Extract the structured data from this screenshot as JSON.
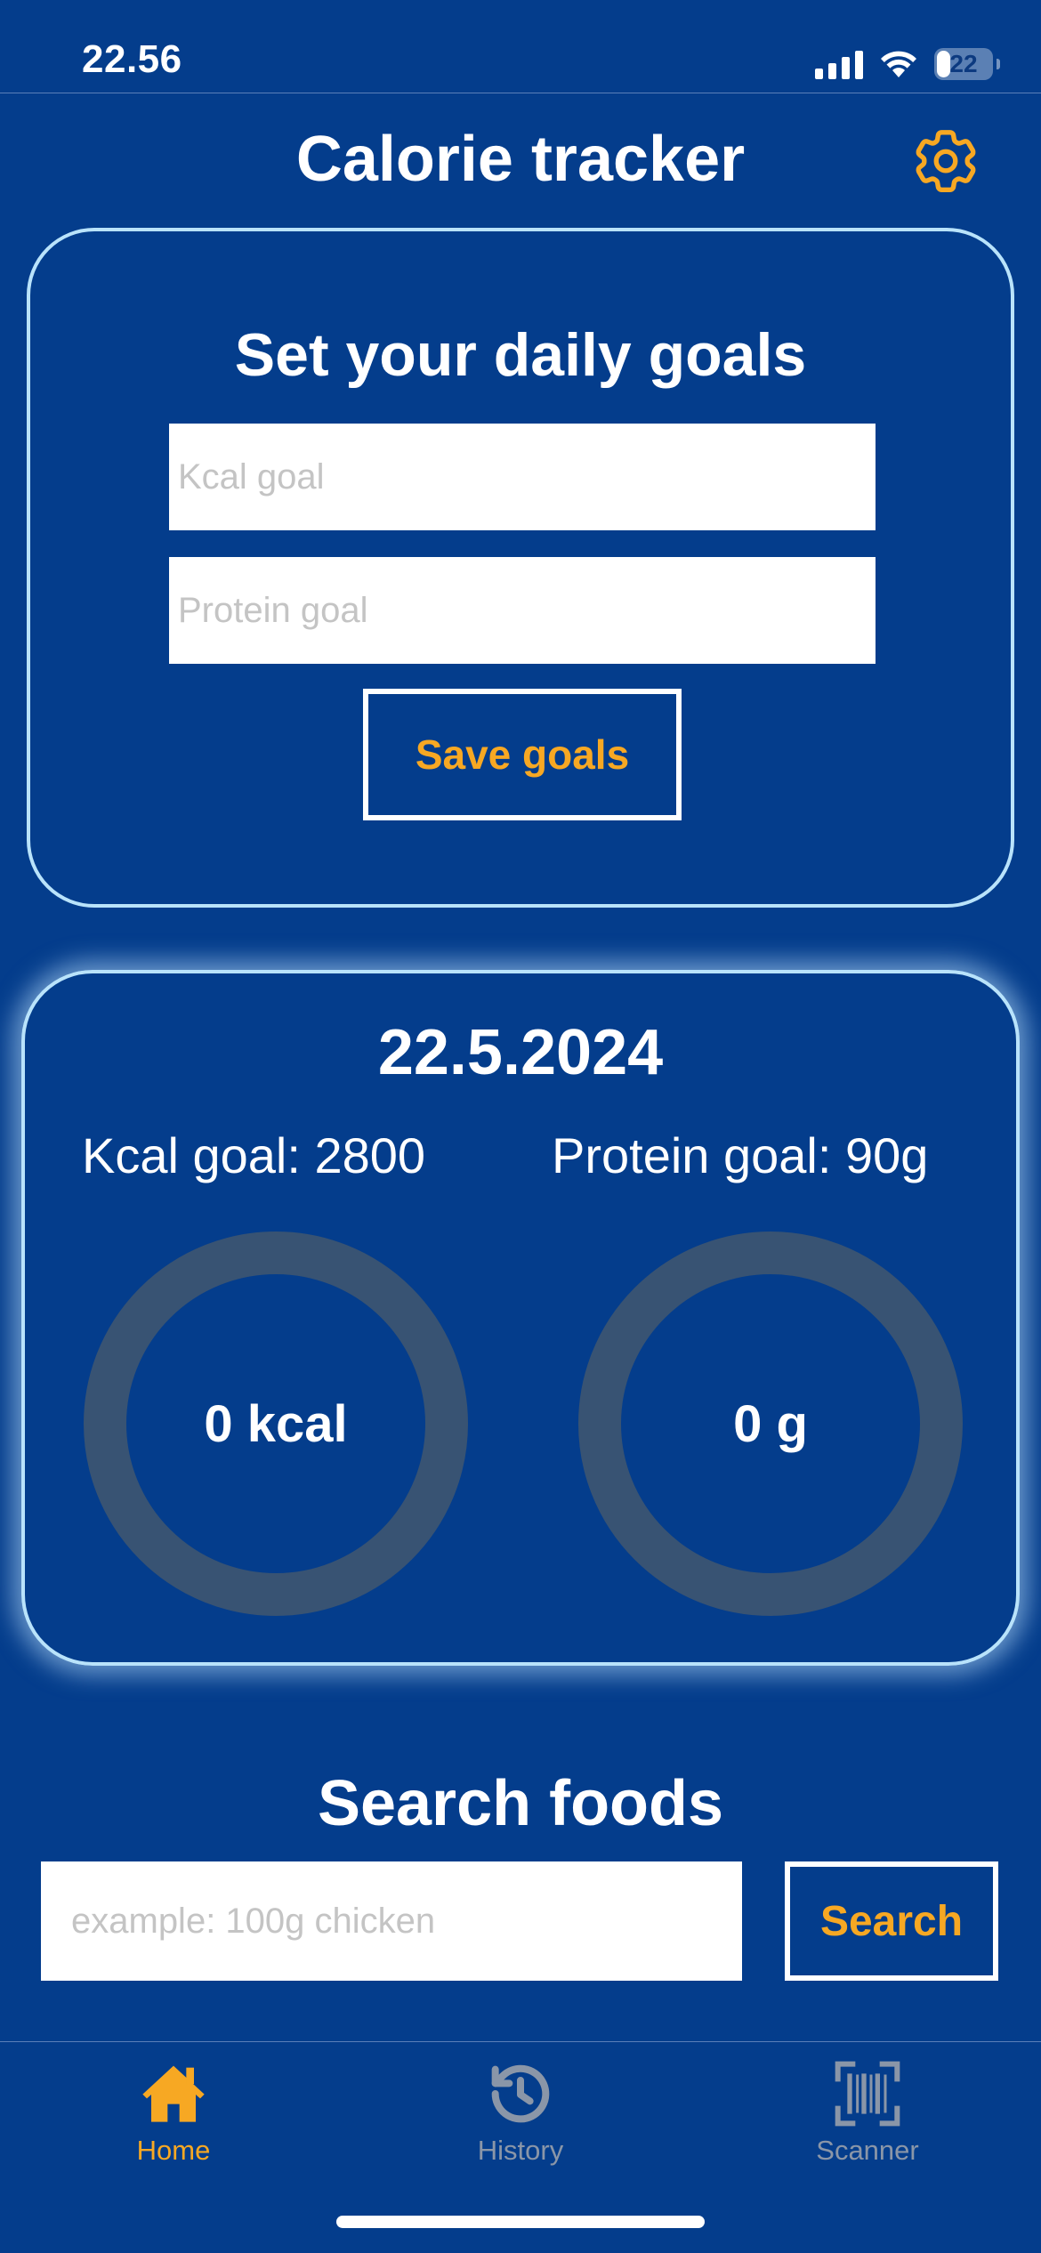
{
  "status_bar": {
    "time": "22.56",
    "battery": "22"
  },
  "header": {
    "title": "Calorie tracker",
    "settings_icon": "gear-icon"
  },
  "goals_card": {
    "title": "Set your daily goals",
    "kcal_placeholder": "Kcal goal",
    "protein_placeholder": "Protein goal",
    "save_label": "Save goals"
  },
  "daily": {
    "date": "22.5.2024",
    "kcal_goal_label": "Kcal goal: 2800",
    "protein_goal_label": "Protein goal: 90g",
    "kcal_value": "0 kcal",
    "protein_value": "0 g",
    "kcal_progress": 0,
    "protein_progress": 0
  },
  "search": {
    "title": "Search foods",
    "placeholder": "example: 100g chicken",
    "button_label": "Search"
  },
  "tabs": [
    {
      "label": "Home",
      "icon": "home-icon",
      "active": true
    },
    {
      "label": "History",
      "icon": "history-icon",
      "active": false
    },
    {
      "label": "Scanner",
      "icon": "barcode-scanner-icon",
      "active": false
    }
  ],
  "colors": {
    "background": "#043d8c",
    "accent": "#f7a823",
    "card_border": "#b9e3fb",
    "ring_track": "#385373",
    "inactive_tab": "#8a96a8"
  }
}
